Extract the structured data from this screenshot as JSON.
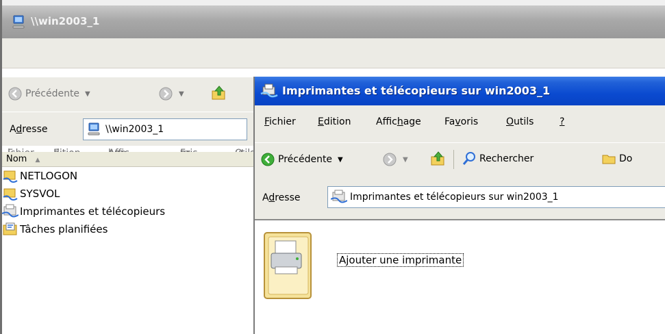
{
  "back_window": {
    "title": "\\\\win2003_1",
    "menu": {
      "fichier": {
        "pre": "",
        "u": "F",
        "post": "ichier"
      },
      "edition": {
        "pre": "",
        "u": "E",
        "post": "dition"
      },
      "affichage": {
        "pre": "Affic",
        "u": "h",
        "post": "age"
      },
      "favoris": {
        "pre": "Fa",
        "u": "v",
        "post": "oris"
      },
      "outils": {
        "pre": "",
        "u": "O",
        "post": "utils"
      },
      "help": {
        "pre": "",
        "u": "?",
        "post": ""
      }
    },
    "toolbar": {
      "back_label": "Précédente"
    },
    "address": {
      "label_pre": "A",
      "label_u": "d",
      "label_post": "resse",
      "value": "\\\\win2003_1"
    },
    "list": {
      "header": "Nom",
      "items": [
        {
          "label": "NETLOGON",
          "icon": "shared-folder-icon"
        },
        {
          "label": "SYSVOL",
          "icon": "shared-folder-icon"
        },
        {
          "label": "Imprimantes et télécopieurs",
          "icon": "printers-folder-icon"
        },
        {
          "label": "Tâches planifiées",
          "icon": "scheduled-tasks-icon"
        }
      ]
    }
  },
  "front_window": {
    "title": "Imprimantes et télécopieurs sur win2003_1",
    "menu": {
      "fichier": {
        "pre": "",
        "u": "F",
        "post": "ichier"
      },
      "edition": {
        "pre": "",
        "u": "E",
        "post": "dition"
      },
      "affichage": {
        "pre": "Affic",
        "u": "h",
        "post": "age"
      },
      "favoris": {
        "pre": "Fa",
        "u": "v",
        "post": "oris"
      },
      "outils": {
        "pre": "",
        "u": "O",
        "post": "utils"
      },
      "help": {
        "pre": "",
        "u": "?",
        "post": ""
      }
    },
    "toolbar": {
      "back_label": "Précédente",
      "search_label": "Rechercher",
      "folders_label": "Do"
    },
    "address": {
      "label_pre": "A",
      "label_u": "d",
      "label_post": "resse",
      "value": "Imprimantes et télécopieurs sur win2003_1"
    },
    "content": {
      "add_printer_label": "Ajouter une imprimante"
    }
  },
  "colors": {
    "active_title": "#0a4ad0",
    "inactive_title": "#a8a8a8",
    "chrome": "#ecebe5"
  }
}
